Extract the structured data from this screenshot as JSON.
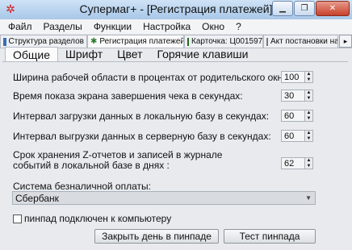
{
  "window": {
    "title": "Супермаг+ - [Регистрация платежей]"
  },
  "menu": [
    "Файл",
    "Разделы",
    "Функции",
    "Настройка",
    "Окно",
    "?"
  ],
  "doc_tabs": [
    {
      "label": "Структура разделов",
      "icon": "grid-icon"
    },
    {
      "label": "Регистрация платежей",
      "icon": "star-icon",
      "active": true,
      "close": "✕"
    },
    {
      "label": "Карточка: Ц001597",
      "icon": "card-icon"
    },
    {
      "label": "Акт постановки на",
      "icon": "document-icon"
    }
  ],
  "settings_tabs": [
    "Общие",
    "Шрифт",
    "Цвет",
    "Горячие клавиши"
  ],
  "fields": {
    "width_label": "Ширина рабочей области в процентах от родительского окна:",
    "width_value": "100",
    "receipt_label": "Время показа экрана завершения чека в секундах:",
    "receipt_value": "30",
    "load_label": "Интервал загрузки данных в локальную базу в секундах:",
    "load_value": "60",
    "upload_label": "Интервал выгрузки данных в серверную базу в секундах:",
    "upload_value": "60",
    "storage_label_line1": "Срок хранения Z-отчетов и записей в журнале",
    "storage_label_line2": "событий в локальной базе в днях :",
    "storage_value": "62"
  },
  "payment": {
    "label": "Система безналичной оплаты:",
    "selected": "Сбербанк"
  },
  "pinpad": {
    "checkbox_label": "пинпад подключен к компьютеру",
    "checked": false,
    "close_day_button": "Закрыть день в пинпаде",
    "test_button": "Тест пинпада"
  }
}
